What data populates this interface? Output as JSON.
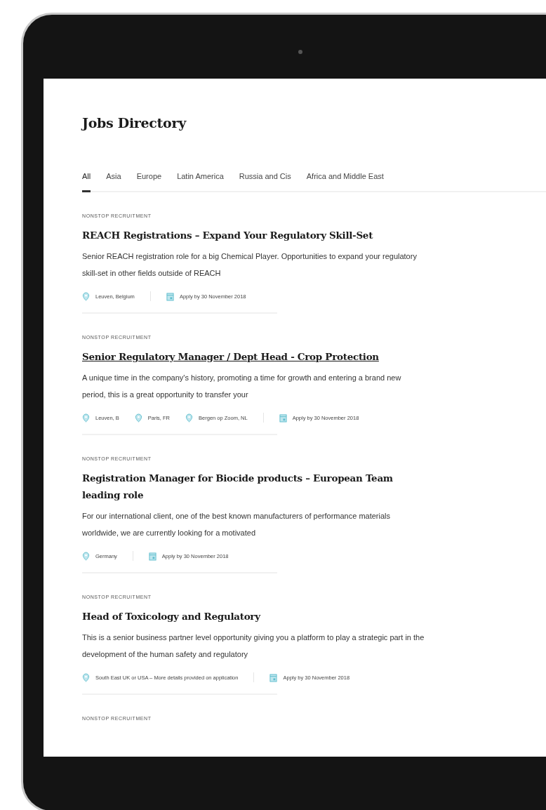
{
  "page": {
    "title": "Jobs Directory"
  },
  "tabs": [
    {
      "label": "All",
      "selected": true
    },
    {
      "label": "Asia",
      "selected": false
    },
    {
      "label": "Europe",
      "selected": false
    },
    {
      "label": "Latin America",
      "selected": false
    },
    {
      "label": "Russia and Cis",
      "selected": false
    },
    {
      "label": "Africa and Middle East",
      "selected": false
    }
  ],
  "jobs": [
    {
      "kicker": "NONSTOP RECRUITMENT",
      "title": "REACH Registrations – Expand Your Regulatory Skill-Set",
      "hovered": false,
      "description": "Senior REACH registration role for a big Chemical Player. Opportunities to expand your regulatory skill-set in other fields outside of REACH",
      "locations": [
        "Leuven, Belgium"
      ],
      "deadline": "Apply by 30 November 2018"
    },
    {
      "kicker": "NONSTOP RECRUITMENT",
      "title": "Senior Regulatory Manager / Dept Head - Crop Protection",
      "hovered": true,
      "description": "A unique time in the company's history, promoting a time for growth and entering a brand new period, this is a great opportunity to transfer your",
      "locations": [
        "Leuven, B",
        "Paris, FR",
        "Bergen op Zoom, NL"
      ],
      "deadline": "Apply by 30 November 2018"
    },
    {
      "kicker": "NONSTOP RECRUITMENT",
      "title": "Registration Manager for Biocide products – European Team leading role",
      "hovered": false,
      "description": "For our international client, one of the best known manufacturers of performance materials worldwide, we are currently looking for a motivated",
      "locations": [
        "Germany"
      ],
      "deadline": "Apply by 30 November 2018"
    },
    {
      "kicker": "NONSTOP RECRUITMENT",
      "title": "Head of Toxicology and Regulatory",
      "hovered": false,
      "description": "This is a senior business partner level opportunity giving you a platform to play a strategic part in the development of the human safety and regulatory",
      "locations": [
        "South East UK or USA – More details provided on application"
      ],
      "deadline": "Apply by 30 November 2018"
    },
    {
      "kicker": "NONSTOP RECRUITMENT"
    }
  ]
}
